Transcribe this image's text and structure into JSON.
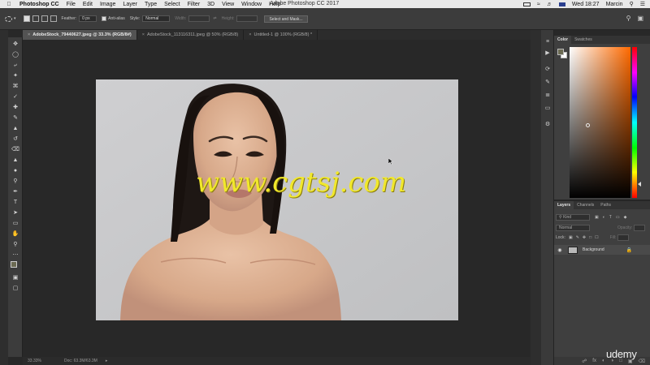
{
  "menubar": {
    "app": "Photoshop CC",
    "items": [
      "File",
      "Edit",
      "Image",
      "Layer",
      "Type",
      "Select",
      "Filter",
      "3D",
      "View",
      "Window",
      "Help"
    ],
    "window_title": "Adobe Photoshop CC 2017",
    "clock": "Wed 18:27",
    "user": "Marcin"
  },
  "options": {
    "feather_label": "Feather:",
    "feather_value": "0 px",
    "antialias_label": "Anti-alias",
    "style_label": "Style:",
    "style_value": "Normal",
    "width_label": "Width:",
    "height_label": "Height:",
    "select_mask_label": "Select and Mask..."
  },
  "tabs": [
    {
      "label": "AdobeStock_79440627.jpeg @ 33.3% (RGB/8#)",
      "active": true
    },
    {
      "label": "AdobeStock_113116311.jpeg @ 50% (RGB/8)",
      "active": false
    },
    {
      "label": "Untitled-1 @ 100% (RGB/8) *",
      "active": false
    }
  ],
  "canvas": {
    "watermark": "www.cgtsj.com"
  },
  "status": {
    "zoom": "33.33%",
    "doc": "Doc: 63.3M/63.3M"
  },
  "color_panel": {
    "tabs": [
      "Color",
      "Swatches"
    ],
    "hue_color": "#ff6a00"
  },
  "layers_panel": {
    "tabs": [
      "Layers",
      "Channels",
      "Paths"
    ],
    "filter_label": "Kind",
    "blend_mode": "Normal",
    "opacity_label": "Opacity:",
    "fill_label": "Fill:",
    "lock_label": "Lock:",
    "layer_name": "Background"
  },
  "brand": "udemy",
  "colors": {
    "accent_watermark": "#f1e82c",
    "canvas_bg": "#c7c8ca",
    "workspace": "#282828"
  }
}
